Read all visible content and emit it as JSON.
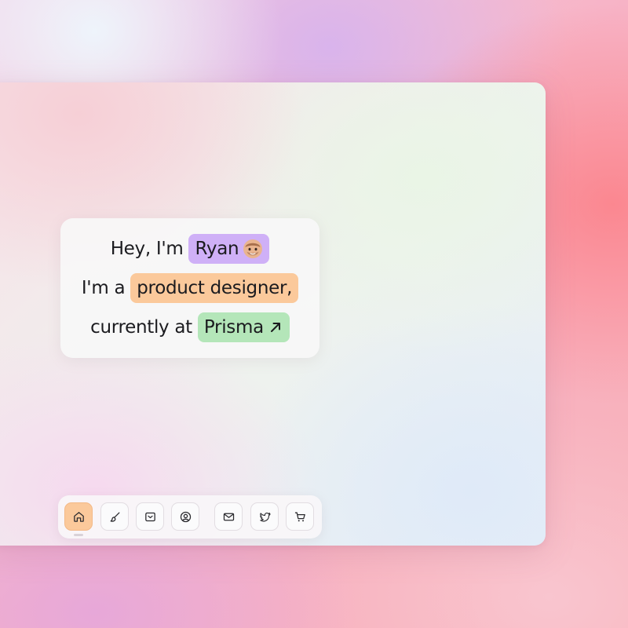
{
  "intro": {
    "greeting_prefix": "Hey, I'm",
    "name": "Ryan",
    "role_prefix": "I'm a",
    "role": "product designer,",
    "company_prefix": "currently at",
    "company": "Prisma",
    "name_avatar_icon": "memoji-avatar-icon",
    "company_link_icon": "arrow-up-right-icon"
  },
  "colors": {
    "name_chip": "#cfb0f7",
    "role_chip": "#fbc99b",
    "company_chip": "#b4e6b9",
    "dock_active": "#fbc99b"
  },
  "dock": {
    "items": [
      {
        "icon": "home-icon",
        "active": true
      },
      {
        "icon": "brush-icon",
        "active": false
      },
      {
        "icon": "inbox-icon",
        "active": false
      },
      {
        "icon": "user-circle-icon",
        "active": false
      },
      {
        "icon": "mail-icon",
        "active": false
      },
      {
        "icon": "twitter-icon",
        "active": false
      },
      {
        "icon": "cart-icon",
        "active": false
      }
    ]
  }
}
